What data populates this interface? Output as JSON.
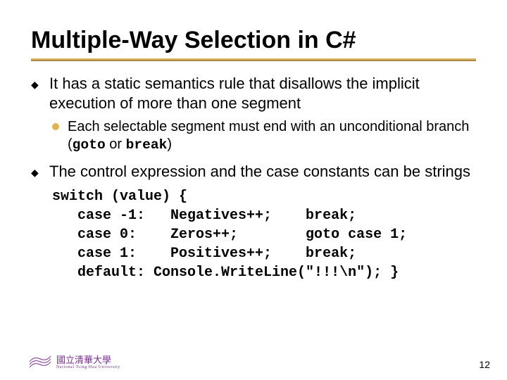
{
  "title": "Multiple-Way Selection in C#",
  "bullets": {
    "item1": "It has a static semantics rule that disallows the implicit execution of more than one segment",
    "item1_sub_pre": "Each selectable segment must end with an unconditional branch (",
    "item1_sub_code1": "goto",
    "item1_sub_mid": " or ",
    "item1_sub_code2": "break",
    "item1_sub_post": ")",
    "item2": "The control expression and the case constants can be strings"
  },
  "code": "switch (value) {\n   case -1:   Negatives++;    break;\n   case 0:    Zeros++;        goto case 1;\n   case 1:    Positives++;    break;\n   default: Console.WriteLine(\"!!!\\n\"); }",
  "footer": {
    "uni_zh": "國立清華大學",
    "uni_en": "National Tsing Hua University",
    "page": "12"
  }
}
